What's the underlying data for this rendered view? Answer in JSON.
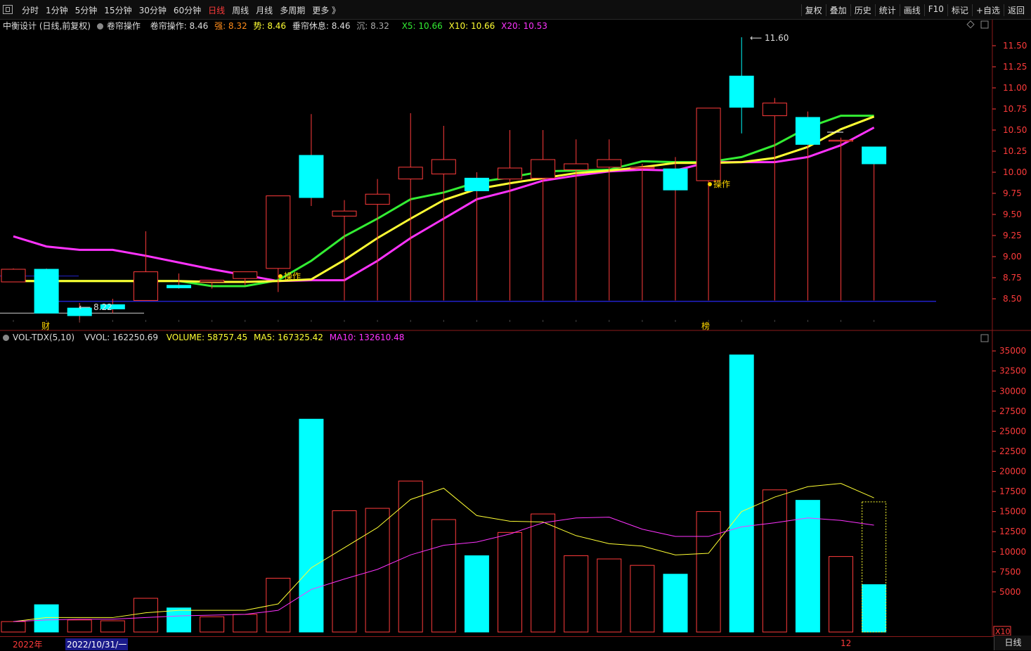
{
  "toolbar": {
    "periods": [
      "分时",
      "1分钟",
      "5分钟",
      "15分钟",
      "30分钟",
      "60分钟",
      "日线",
      "周线",
      "月线",
      "多周期",
      "更多 》"
    ],
    "active_period": "日线",
    "tools": [
      "复权",
      "叠加",
      "历史",
      "统计",
      "画线",
      "F10",
      "标记",
      "+自选",
      "返回"
    ]
  },
  "info": {
    "stock": "中衡设计 (日线,前复权)",
    "indicator": "卷帘操作",
    "op_label": "卷帘操作: 8.46",
    "strong_label": "强: 8.32",
    "trend_label": "势: 8.46",
    "rest_label": "垂帘休息: 8.46",
    "sink_label": "沉: 8.32",
    "x5_label": "X5: 10.66",
    "x10_label": "X10: 10.66",
    "x20_label": "X20: 10.53"
  },
  "vol_info": {
    "name": "VOL-TDX(5,10)",
    "vvol": "VVOL: 162250.69",
    "volume": "VOLUME: 58757.45",
    "ma5": "MA5: 167325.42",
    "ma10": "MA10: 132610.48"
  },
  "markers": {
    "high_label": "11.60",
    "low_label": "8.22",
    "op_marker": "操作",
    "cai": "财",
    "bang": "榜",
    "x10": "X10"
  },
  "bottom": {
    "year": "2022年",
    "date": "2022/10/31/一",
    "month": "12",
    "right_button": "日线"
  },
  "colors": {
    "up": "#ff3b3b",
    "down": "#00ffff",
    "x5": "#33ee33",
    "x10": "#ffff33",
    "x20": "#ff33ff",
    "base": "#2222cc"
  },
  "chart_data": [
    {
      "type": "candlestick",
      "title": "",
      "ylim": [
        8.25,
        11.75
      ],
      "yticks": [
        "11.50",
        "11.25",
        "11.00",
        "10.75",
        "10.50",
        "10.25",
        "10.00",
        "9.75",
        "9.50",
        "9.25",
        "9.00",
        "8.75",
        "8.50"
      ],
      "candles": [
        {
          "o": 8.7,
          "c": 8.85,
          "h": 8.86,
          "l": 8.7
        },
        {
          "o": 8.85,
          "c": 8.33,
          "h": 8.86,
          "l": 8.33
        },
        {
          "o": 8.39,
          "c": 8.3,
          "h": 8.45,
          "l": 8.22
        },
        {
          "o": 8.43,
          "c": 8.38,
          "h": 8.5,
          "l": 8.33
        },
        {
          "o": 8.48,
          "c": 8.82,
          "h": 9.3,
          "l": 8.48
        },
        {
          "o": 8.66,
          "c": 8.63,
          "h": 8.8,
          "l": 8.62
        },
        {
          "o": 8.7,
          "c": 8.72,
          "h": 8.72,
          "l": 8.62
        },
        {
          "o": 8.74,
          "c": 8.82,
          "h": 8.82,
          "l": 8.66
        },
        {
          "o": 8.86,
          "c": 9.72,
          "h": 9.72,
          "l": 8.58
        },
        {
          "o": 10.2,
          "c": 9.7,
          "h": 10.69,
          "l": 9.6
        },
        {
          "o": 9.48,
          "c": 9.54,
          "h": 9.67,
          "l": 8.48
        },
        {
          "o": 9.62,
          "c": 9.74,
          "h": 9.92,
          "l": 8.48
        },
        {
          "o": 9.92,
          "c": 10.06,
          "h": 10.7,
          "l": 8.48
        },
        {
          "o": 9.98,
          "c": 10.15,
          "h": 10.55,
          "l": 8.48
        },
        {
          "o": 9.93,
          "c": 9.78,
          "h": 10.0,
          "l": 8.48
        },
        {
          "o": 9.92,
          "c": 10.05,
          "h": 10.5,
          "l": 8.48
        },
        {
          "o": 9.93,
          "c": 10.15,
          "h": 10.5,
          "l": 8.48
        },
        {
          "o": 10.03,
          "c": 10.1,
          "h": 10.39,
          "l": 8.48
        },
        {
          "o": 10.06,
          "c": 10.15,
          "h": 10.39,
          "l": 8.48
        },
        {
          "o": 10.06,
          "c": 10.06,
          "h": 10.1,
          "l": 8.48
        },
        {
          "o": 10.04,
          "c": 9.79,
          "h": 10.18,
          "l": 8.48
        },
        {
          "o": 9.9,
          "c": 10.76,
          "h": 10.76,
          "l": 8.48
        },
        {
          "o": 11.14,
          "c": 10.77,
          "h": 11.6,
          "l": 10.46
        },
        {
          "o": 10.67,
          "c": 10.82,
          "h": 10.88,
          "l": 8.48
        },
        {
          "o": 10.65,
          "c": 10.33,
          "h": 10.72,
          "l": 8.48
        },
        {
          "o": 10.38,
          "c": 10.38,
          "h": 10.41,
          "l": 8.48
        },
        {
          "o": 10.3,
          "c": 10.1,
          "h": 10.3,
          "l": 8.48
        }
      ],
      "series": [
        {
          "name": "X5",
          "values": [
            8.71,
            8.71,
            8.71,
            8.71,
            8.71,
            8.71,
            8.65,
            8.65,
            8.72,
            8.95,
            9.24,
            9.45,
            9.68,
            9.76,
            9.88,
            9.94,
            10.01,
            10.02,
            10.03,
            10.13,
            10.12,
            10.12,
            10.18,
            10.32,
            10.53,
            10.67,
            10.67
          ]
        },
        {
          "name": "X10",
          "values": [
            8.71,
            8.71,
            8.71,
            8.71,
            8.71,
            8.71,
            8.7,
            8.7,
            8.71,
            8.73,
            8.96,
            9.22,
            9.45,
            9.67,
            9.8,
            9.87,
            9.93,
            9.99,
            10.02,
            10.06,
            10.11,
            10.11,
            10.12,
            10.17,
            10.3,
            10.51,
            10.66
          ]
        },
        {
          "name": "X20",
          "values": [
            9.24,
            9.12,
            9.08,
            9.08,
            9.01,
            8.93,
            8.85,
            8.78,
            8.71,
            8.72,
            8.72,
            8.95,
            9.22,
            9.45,
            9.68,
            9.78,
            9.9,
            9.96,
            10.01,
            10.03,
            10.02,
            10.12,
            10.12,
            10.12,
            10.18,
            10.32,
            10.53
          ]
        }
      ]
    },
    {
      "type": "bar",
      "title": "",
      "ylim": [
        0,
        36500
      ],
      "yticks": [
        "35000",
        "32500",
        "30000",
        "27500",
        "25000",
        "22500",
        "20000",
        "17500",
        "15000",
        "12500",
        "10000",
        "7500",
        "5000"
      ],
      "values": [
        1300,
        3400,
        1500,
        1400,
        4200,
        3000,
        1900,
        2200,
        6700,
        26500,
        15100,
        15400,
        18800,
        14000,
        9500,
        12400,
        14700,
        9500,
        9100,
        8300,
        7200,
        15000,
        34500,
        17700,
        16400,
        9400,
        5900
      ],
      "up": [
        1,
        0,
        1,
        1,
        1,
        0,
        1,
        1,
        1,
        0,
        1,
        1,
        1,
        1,
        0,
        1,
        1,
        1,
        1,
        1,
        0,
        1,
        0,
        1,
        0,
        1,
        0
      ],
      "series": [
        {
          "name": "MA5",
          "values": [
            1300,
            1800,
            1800,
            1800,
            2400,
            2700,
            2700,
            2700,
            3500,
            8000,
            10500,
            13000,
            16500,
            17900,
            14500,
            13800,
            13700,
            12000,
            11000,
            10700,
            9600,
            9800,
            15000,
            16800,
            18100,
            18500,
            16700
          ]
        },
        {
          "name": "MA10",
          "values": [
            1300,
            1500,
            1600,
            1600,
            1800,
            2000,
            2100,
            2200,
            2700,
            5300,
            6600,
            7800,
            9600,
            10800,
            11200,
            12200,
            13600,
            14200,
            14300,
            12800,
            11900,
            11900,
            13100,
            13600,
            14200,
            13900,
            13300
          ]
        }
      ],
      "last_bar_outline": 16200
    }
  ]
}
